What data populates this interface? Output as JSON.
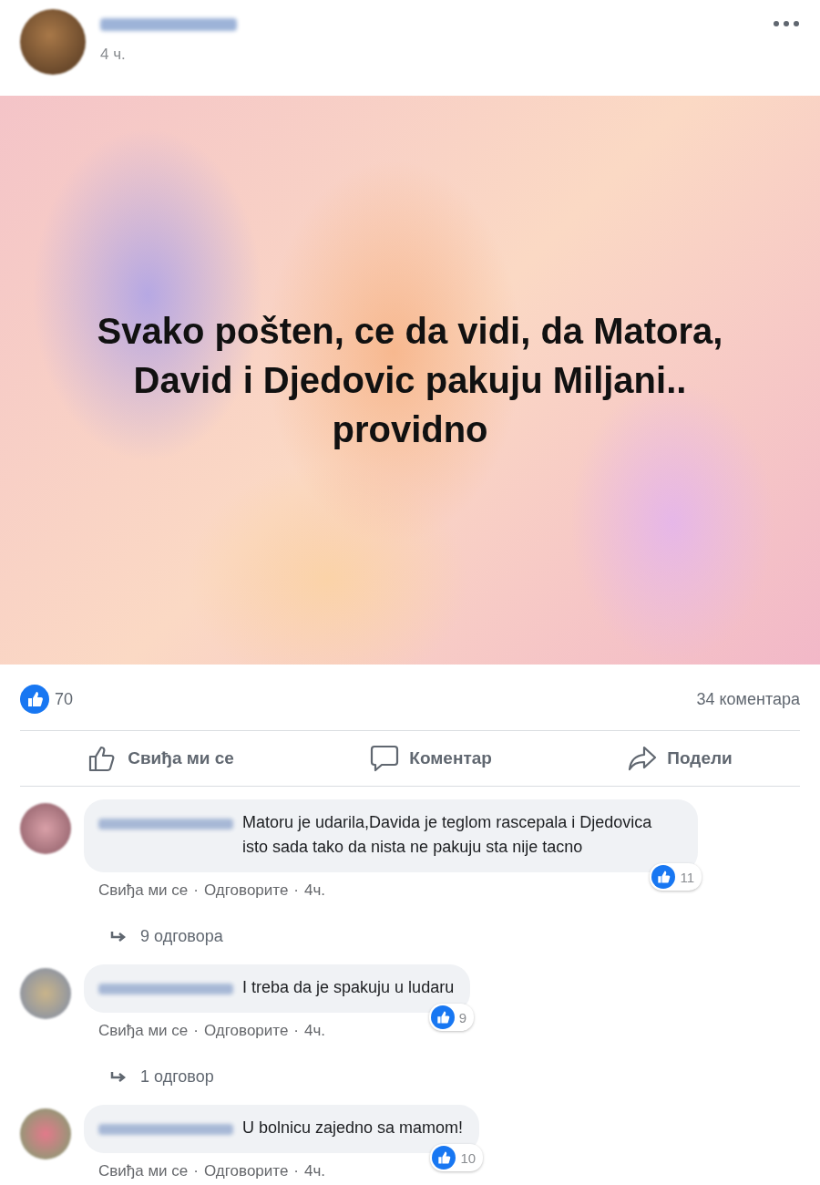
{
  "post": {
    "time": "4 ч.",
    "text": "Svako pošten, ce da vidi, da Matora, David i Djedovic pakuju Miljani.. providno"
  },
  "stats": {
    "likes": "70",
    "comments": "34 коментара"
  },
  "actions": [
    {
      "kind": "like",
      "label": "Свиђа ми се"
    },
    {
      "kind": "comment",
      "label": "Коментар"
    },
    {
      "kind": "share",
      "label": "Подели"
    }
  ],
  "comments": [
    {
      "text": "Matoru je udarila,Davida je teglom rascepala i Djedovica isto sada tako da nista ne pakuju sta nije tacno",
      "likes": "11",
      "like_link": "Свиђа ми се",
      "reply_link": "Одговорите",
      "time": "4ч.",
      "separators": [
        "·",
        "·"
      ],
      "replies": "9 одговора"
    },
    {
      "text": "I treba da je spakuju u ludaru",
      "likes": "9",
      "like_link": "Свиђа ми се",
      "reply_link": "Одговорите",
      "time": "4ч.",
      "separators": [
        "·",
        "·"
      ],
      "replies": "1 одговор"
    },
    {
      "text": "U bolnicu zajedno sa mamom!",
      "likes": "10",
      "like_link": "Свиђа ми се",
      "reply_link": "Одговорите",
      "time": "4ч.",
      "separators": [
        "·",
        "·"
      ]
    }
  ]
}
